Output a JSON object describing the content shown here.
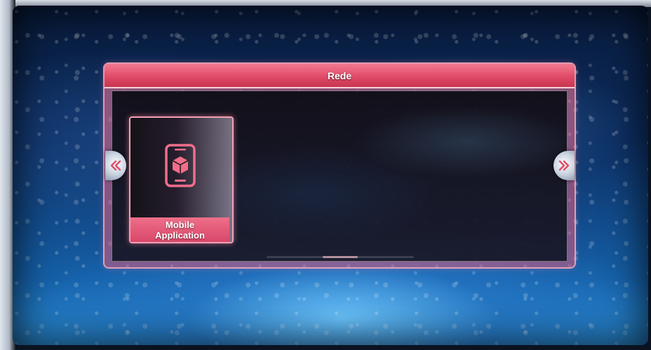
{
  "dialog": {
    "title": "Rede"
  },
  "apps": [
    {
      "label_line1": "Mobile",
      "label_line2": "Application",
      "icon": "mobile-phone-cube-icon",
      "selected": true
    }
  ],
  "navigation": {
    "left_icon": "chevron-left-double-icon",
    "right_icon": "chevron-right-double-icon"
  },
  "colors": {
    "accent": "#e04b68",
    "highlight": "#f2a0b3",
    "text": "#ffffff"
  }
}
